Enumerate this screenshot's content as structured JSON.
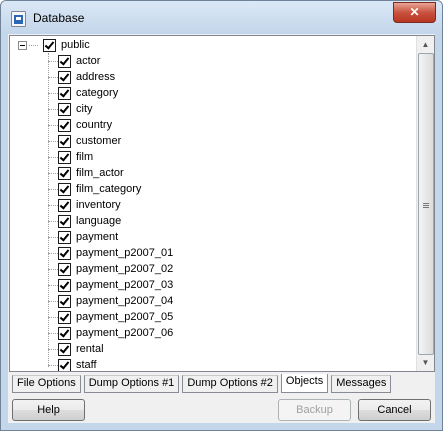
{
  "window": {
    "title": "Database",
    "close_label": "✕"
  },
  "tree": {
    "root": {
      "label": "public",
      "checked": true,
      "expanded": true
    },
    "items": [
      {
        "label": "actor",
        "checked": true
      },
      {
        "label": "address",
        "checked": true
      },
      {
        "label": "category",
        "checked": true
      },
      {
        "label": "city",
        "checked": true
      },
      {
        "label": "country",
        "checked": true
      },
      {
        "label": "customer",
        "checked": true
      },
      {
        "label": "film",
        "checked": true
      },
      {
        "label": "film_actor",
        "checked": true
      },
      {
        "label": "film_category",
        "checked": true
      },
      {
        "label": "inventory",
        "checked": true
      },
      {
        "label": "language",
        "checked": true
      },
      {
        "label": "payment",
        "checked": true
      },
      {
        "label": "payment_p2007_01",
        "checked": true
      },
      {
        "label": "payment_p2007_02",
        "checked": true
      },
      {
        "label": "payment_p2007_03",
        "checked": true
      },
      {
        "label": "payment_p2007_04",
        "checked": true
      },
      {
        "label": "payment_p2007_05",
        "checked": true
      },
      {
        "label": "payment_p2007_06",
        "checked": true
      },
      {
        "label": "rental",
        "checked": true
      },
      {
        "label": "staff",
        "checked": true
      }
    ]
  },
  "tabs": [
    {
      "label": "File Options",
      "active": false
    },
    {
      "label": "Dump Options #1",
      "active": false
    },
    {
      "label": "Dump Options #2",
      "active": false
    },
    {
      "label": "Objects",
      "active": true
    },
    {
      "label": "Messages",
      "active": false
    }
  ],
  "buttons": {
    "help": "Help",
    "backup": "Backup",
    "cancel": "Cancel"
  },
  "scrollbar": {
    "up_arrow": "▲",
    "down_arrow": "▼"
  }
}
